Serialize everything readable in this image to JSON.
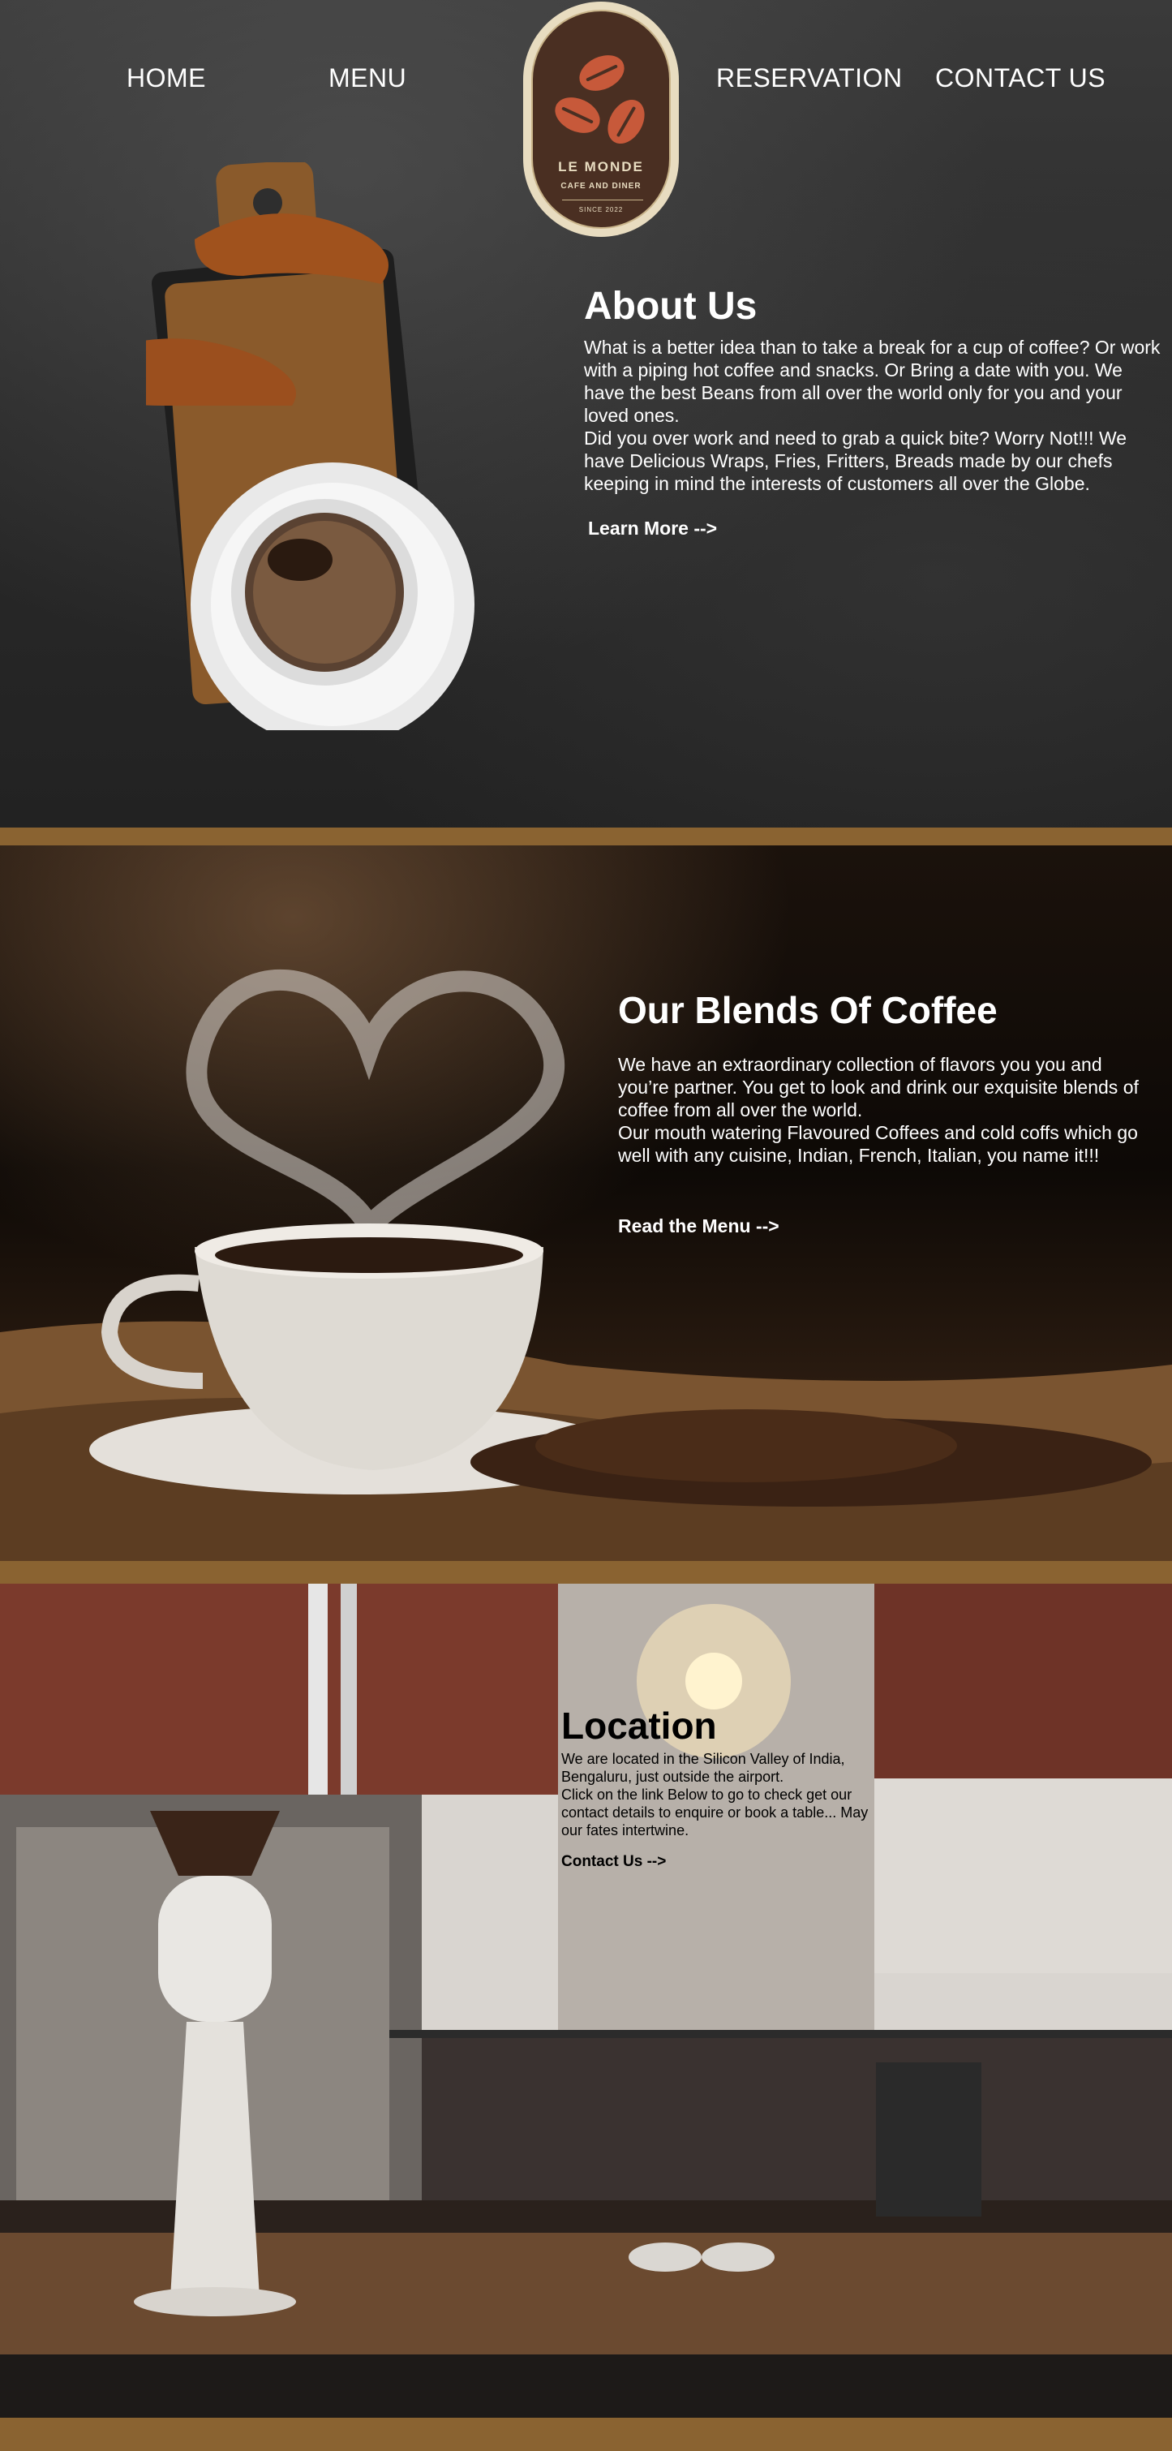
{
  "nav": {
    "home": "HOME",
    "menu": "MENU",
    "reservation": "RESERVATION",
    "contact": "CONTACT US"
  },
  "logo": {
    "name": "LE MONDE",
    "tagline": "CAFE AND DINER",
    "since": "SINCE 2022"
  },
  "about": {
    "title": "About Us",
    "paragraph1": "What is a better idea than to take a break for a cup of coffee? Or work with a piping hot coffee and snacks. Or Bring a date with you. We have the best Beans from all over the world only for you and your loved ones.",
    "paragraph2": "Did you over work and need to grab a quick bite? Worry Not!!! We have Delicious Wraps, Fries, Fritters, Breads made by our chefs keeping in mind the interests of customers all over the Globe.",
    "link": "Learn More -->"
  },
  "blends": {
    "title": "Our Blends Of Coffee",
    "paragraph1": "We have an extraordinary collection of flavors you you and you’re partner. You get to look and drink our exquisite blends of coffee from all over the world.",
    "paragraph2": "Our mouth watering Flavoured Coffees and cold coffs which go well with any cuisine, Indian, French, Italian, you name it!!!",
    "link": "Read the Menu -->"
  },
  "location": {
    "title": "Location",
    "paragraph1": "We are located in the Silicon Valley of India, Bengaluru, just outside the airport.",
    "paragraph2": "Click on the link Below to go to check get our contact details to enquire or book a table... May our fates intertwine.",
    "link": "Contact Us -->"
  },
  "colors": {
    "band": "#8a6331",
    "logo_bg": "#4a2f22",
    "logo_ring": "#e8dcc0",
    "bean": "#c7593a"
  }
}
